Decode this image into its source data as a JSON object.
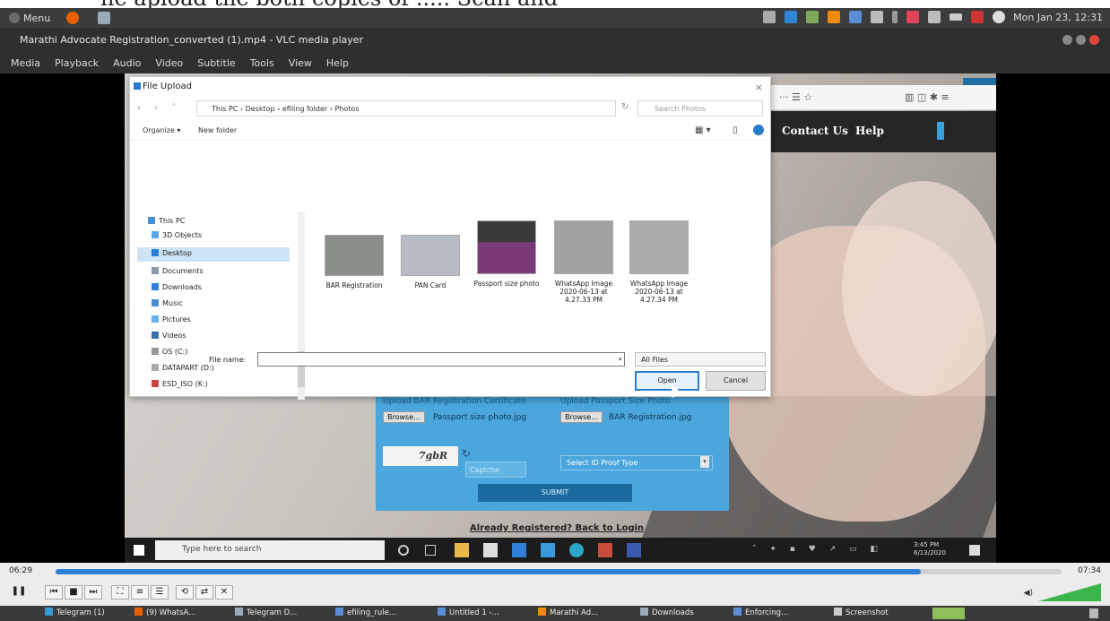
{
  "caption": "he apload the both copies of ..... Scan and",
  "top_panel": {
    "menu_label": "Menu",
    "clock": "Mon Jan 23, 12:31"
  },
  "vlc": {
    "title": "Marathi Advocate Registration_converted (1).mp4 - VLC media player",
    "menu": [
      "Media",
      "Playback",
      "Audio",
      "Video",
      "Subtitle",
      "Tools",
      "View",
      "Help"
    ],
    "time_elapsed": "06:29",
    "time_total": "07:34",
    "progress": 0.86
  },
  "dialog": {
    "title": "File Upload",
    "close": "×",
    "address": "This PC  ›  Desktop  ›  efiling folder  ›  Photos",
    "search_placeholder": "Search Photos",
    "toolbar": {
      "organize": "Organize ▾",
      "new_folder": "New folder"
    },
    "nav": [
      "This PC",
      "3D Objects",
      "Desktop",
      "Documents",
      "Downloads",
      "Music",
      "Pictures",
      "Videos",
      "OS (C:)",
      "DATAPART (D:)",
      "ESD_ISO (K:)"
    ],
    "files": [
      {
        "label": "BAR Registration",
        "color": "#8a8f8a"
      },
      {
        "label": "PAN Card",
        "color": "#b7bcc4"
      },
      {
        "label": "Passport size photo",
        "color": "#7a3a7a"
      },
      {
        "label": "WhatsApp Image 2020-06-13 at 4.27.33 PM",
        "color": "#9fa29e"
      },
      {
        "label": "WhatsApp Image 2020-06-13 at 4.27.34 PM",
        "color": "#a9aca8"
      }
    ],
    "file_name_label": "File name:",
    "file_type": "All Files",
    "open_label": "Open",
    "cancel_label": "Cancel"
  },
  "site": {
    "nav_links": [
      "Contact Us",
      "Help"
    ],
    "browser_icons": "··· ☰ ☆",
    "form": {
      "upload_label_1": "Upload BAR Registration Certificate",
      "upload_label_2": "Upload Passport Size Photo",
      "browse": "Browse...",
      "file_1": "Passport size photo.jpg",
      "file_2": "BAR Registration.jpg",
      "captcha": "7gbR",
      "captcha_placeholder": "Captcha",
      "select_placeholder": "Select ID Proof Type",
      "submit": "SUBMIT"
    },
    "already": "Already Registered?  Back to Login"
  },
  "win_taskbar": {
    "search_placeholder": "Type here to search",
    "time": "3:45 PM",
    "date": "6/13/2020"
  },
  "bottom_panel": [
    "Telegram (1)",
    "(9) WhatsA...",
    "Telegram D...",
    "efiling_rule...",
    "Untitled 1 -...",
    "Marathi Ad...",
    "Downloads",
    "Enforcing...",
    "Screenshot"
  ]
}
